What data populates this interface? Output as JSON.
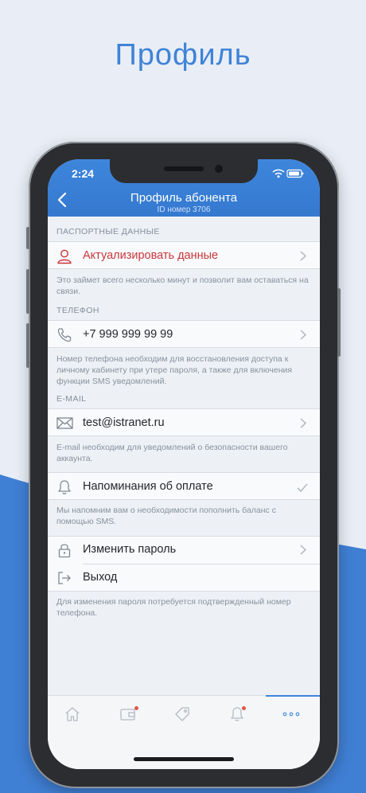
{
  "promo": {
    "title": "Профиль"
  },
  "status_bar": {
    "time": "2:24"
  },
  "nav": {
    "title": "Профиль абонента",
    "subtitle": "ID номер 3706"
  },
  "passport": {
    "header": "ПАСПОРТНЫЕ ДАННЫЕ",
    "action_label": "Актуализировать данные",
    "note": "Это займет всего несколько минут и позволит вам оставаться на связи."
  },
  "phone": {
    "header": "ТЕЛЕФОН",
    "value": "+7 999 999 99 99",
    "note": "Номер телефона необходим для восстановления доступа к личному кабинету при утере пароля, а также для включения функции SMS уведомлений."
  },
  "email": {
    "header": "E-MAIL",
    "value": "test@istranet.ru",
    "note": "E-mail необходим для уведомлений о безопасности вашего аккаунта."
  },
  "reminders": {
    "label": "Напоминания об оплате",
    "enabled": true,
    "note": "Мы напомним вам о необходимости пополнить баланс с помощью SMS."
  },
  "security": {
    "change_password": "Изменить пароль",
    "logout": "Выход",
    "note": "Для изменения пароля потребуется подтвержденный номер телефона."
  },
  "tabbar": {
    "items": [
      {
        "icon": "home-icon",
        "active": false,
        "badge": false
      },
      {
        "icon": "wallet-icon",
        "active": false,
        "badge": true
      },
      {
        "icon": "tag-icon",
        "active": false,
        "badge": false
      },
      {
        "icon": "bell-icon",
        "active": false,
        "badge": true
      },
      {
        "icon": "more-icon",
        "active": true,
        "badge": false
      }
    ]
  },
  "colors": {
    "accent": "#3d86dc",
    "danger": "#c9363a",
    "badge": "#e2574c",
    "background": "#e9eef6"
  }
}
